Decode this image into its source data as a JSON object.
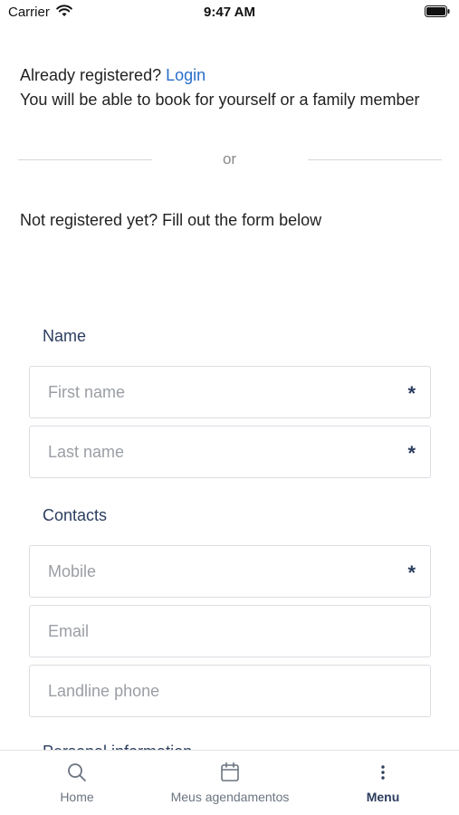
{
  "status_bar": {
    "carrier": "Carrier",
    "time": "9:47 AM"
  },
  "intro": {
    "already_registered": "Already registered?",
    "login_link": "Login",
    "book_info": "You will be able to book for yourself or a family member"
  },
  "divider": {
    "text": "or"
  },
  "not_registered": "Not registered yet? Fill out the form below",
  "form": {
    "name_section": {
      "title": "Name",
      "first_name_placeholder": "First name",
      "last_name_placeholder": "Last name"
    },
    "contacts_section": {
      "title": "Contacts",
      "mobile_placeholder": "Mobile",
      "email_placeholder": "Email",
      "landline_placeholder": "Landline phone"
    },
    "required_mark": "*",
    "next_section_partial": "Personal information"
  },
  "tab_bar": {
    "items": [
      {
        "label": "Home",
        "icon": "search-icon"
      },
      {
        "label": "Meus agendamentos",
        "icon": "calendar-icon"
      },
      {
        "label": "Menu",
        "icon": "more-vertical-icon",
        "active": true
      }
    ]
  },
  "colors": {
    "link": "#2a6ec9",
    "section_title": "#2c3e5f",
    "placeholder": "#9a9ea4",
    "border": "#dadde2"
  }
}
